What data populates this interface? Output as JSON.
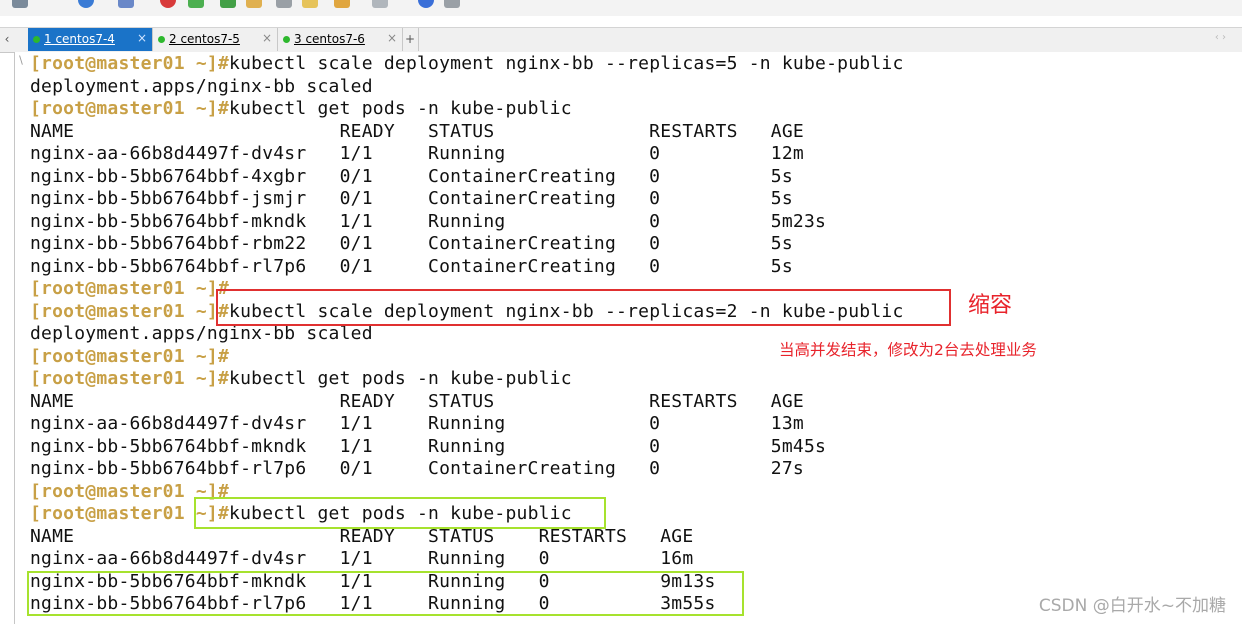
{
  "tabs": [
    {
      "label": "1 centos7-4",
      "active": true,
      "status_color": "#2db82d"
    },
    {
      "label": "2 centos7-5",
      "active": false,
      "status_color": "#2db82d"
    },
    {
      "label": "3 centos7-6",
      "active": false,
      "status_color": "#2db82d"
    }
  ],
  "tab_add_label": "+",
  "tab_close_glyph": "×",
  "accent_color": "#1a73c8",
  "terminal": {
    "prompt": "[root@master01 ~]#",
    "lines": [
      {
        "prompt": "[root@master01 ~]#",
        "text": "kubectl scale deployment nginx-bb --replicas=5 -n kube-public"
      },
      {
        "text": "deployment.apps/nginx-bb scaled"
      },
      {
        "prompt": "[root@master01 ~]#",
        "text": "kubectl get pods -n kube-public"
      },
      {
        "text": "NAME                        READY   STATUS              RESTARTS   AGE"
      },
      {
        "text": "nginx-aa-66b8d4497f-dv4sr   1/1     Running             0          12m"
      },
      {
        "text": "nginx-bb-5bb6764bbf-4xgbr   0/1     ContainerCreating   0          5s"
      },
      {
        "text": "nginx-bb-5bb6764bbf-jsmjr   0/1     ContainerCreating   0          5s"
      },
      {
        "text": "nginx-bb-5bb6764bbf-mkndk   1/1     Running             0          5m23s"
      },
      {
        "text": "nginx-bb-5bb6764bbf-rbm22   0/1     ContainerCreating   0          5s"
      },
      {
        "text": "nginx-bb-5bb6764bbf-rl7p6   0/1     ContainerCreating   0          5s"
      },
      {
        "prompt": "[root@master01 ~]#",
        "text": ""
      },
      {
        "prompt": "[root@master01 ~]#",
        "text": "kubectl scale deployment nginx-bb --replicas=2 -n kube-public"
      },
      {
        "text": "deployment.apps/nginx-bb scaled"
      },
      {
        "prompt": "[root@master01 ~]#",
        "text": ""
      },
      {
        "prompt": "[root@master01 ~]#",
        "text": "kubectl get pods -n kube-public"
      },
      {
        "text": "NAME                        READY   STATUS              RESTARTS   AGE"
      },
      {
        "text": "nginx-aa-66b8d4497f-dv4sr   1/1     Running             0          13m"
      },
      {
        "text": "nginx-bb-5bb6764bbf-mkndk   1/1     Running             0          5m45s"
      },
      {
        "text": "nginx-bb-5bb6764bbf-rl7p6   0/1     ContainerCreating   0          27s"
      },
      {
        "prompt": "[root@master01 ~]#",
        "text": ""
      },
      {
        "prompt": "[root@master01 ~]#",
        "text": "kubectl get pods -n kube-public"
      },
      {
        "text": "NAME                        READY   STATUS    RESTARTS   AGE"
      },
      {
        "text": "nginx-aa-66b8d4497f-dv4sr   1/1     Running   0          16m"
      },
      {
        "text": "nginx-bb-5bb6764bbf-mkndk   1/1     Running   0          9m13s"
      },
      {
        "text": "nginx-bb-5bb6764bbf-rl7p6   1/1     Running   0          3m55s"
      }
    ]
  },
  "annotations": {
    "title": "缩容",
    "note": "当高并发结束，修改为2台去处理业务"
  },
  "watermark": "CSDN @白开水~不加糖"
}
